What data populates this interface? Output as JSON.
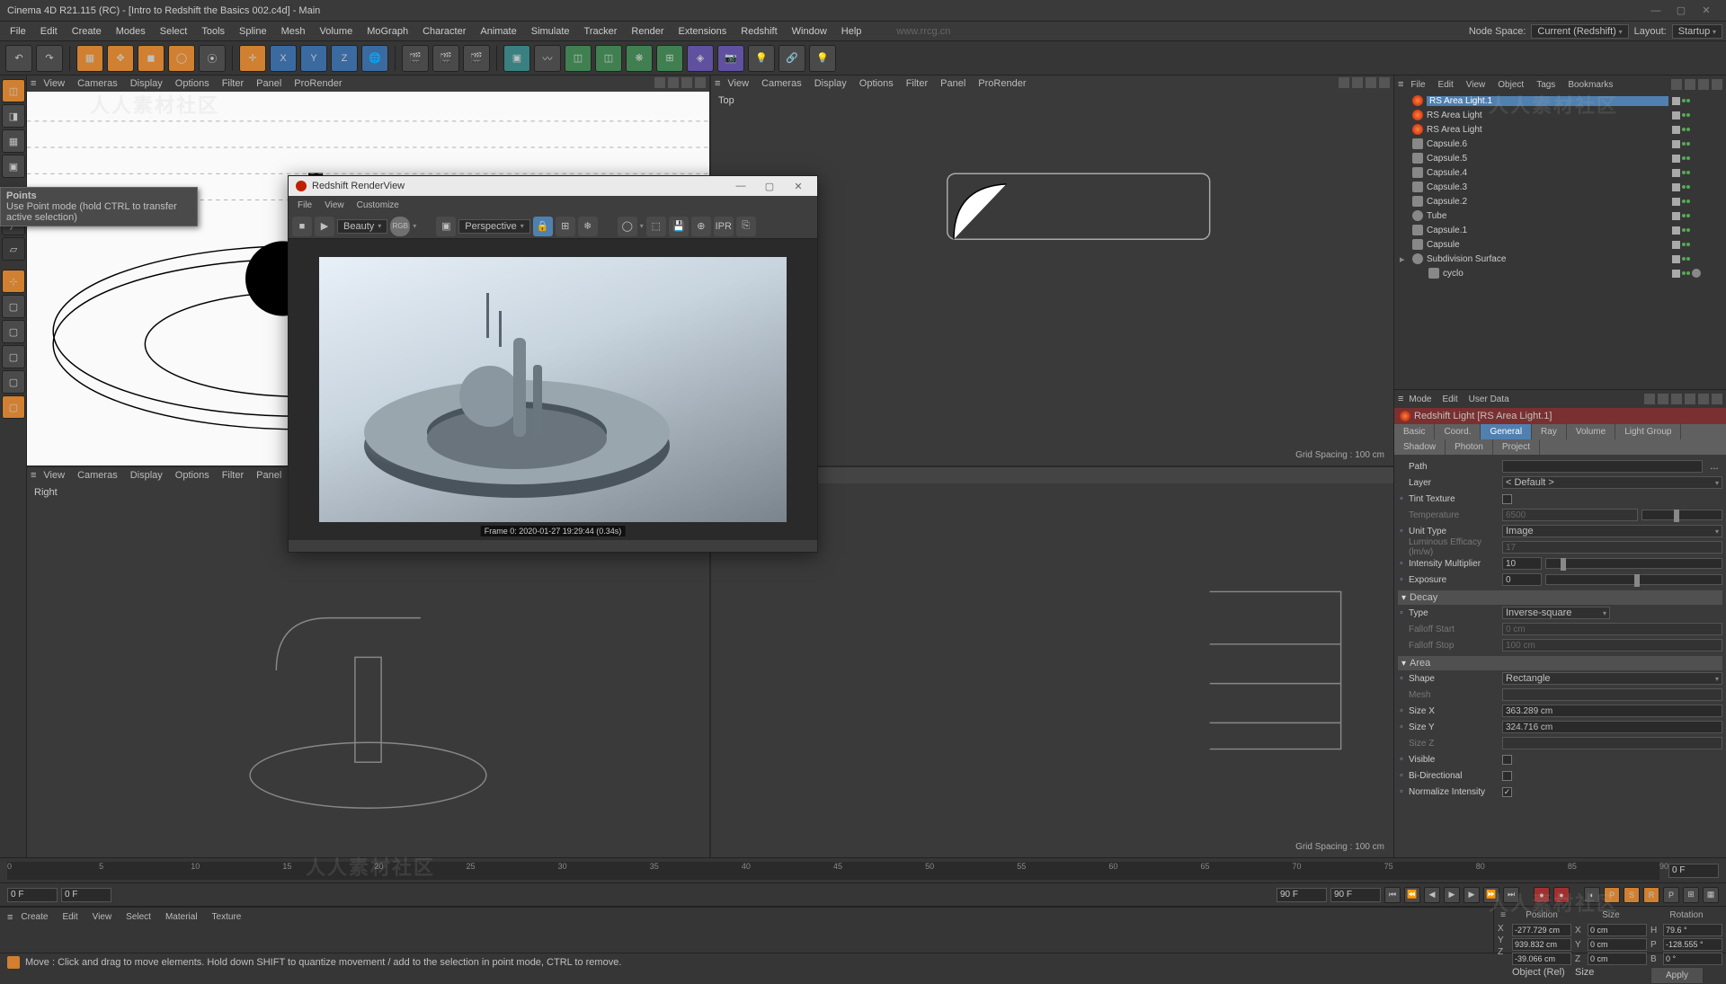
{
  "window": {
    "title": "Cinema 4D R21.115 (RC) - [Intro to Redshift the Basics 002.c4d] - Main",
    "watermark_url": "www.rrcg.cn",
    "watermark_text": "人人素材社区"
  },
  "menubar": {
    "items": [
      "File",
      "Edit",
      "Create",
      "Modes",
      "Select",
      "Tools",
      "Spline",
      "Mesh",
      "Volume",
      "MoGraph",
      "Character",
      "Animate",
      "Simulate",
      "Tracker",
      "Render",
      "Extensions",
      "Redshift",
      "Window",
      "Help"
    ],
    "node_space_label": "Node Space:",
    "node_space_value": "Current (Redshift)",
    "layout_label": "Layout:",
    "layout_value": "Startup"
  },
  "viewport_menu": [
    "View",
    "Cameras",
    "Display",
    "Options",
    "Filter",
    "Panel",
    "ProRender"
  ],
  "viewports": {
    "top": "Top",
    "right": "Right",
    "grid": "Grid Spacing : 100 cm"
  },
  "tooltip": {
    "title": "Points",
    "body": "Use Point mode (hold CTRL to transfer active selection)"
  },
  "renderview": {
    "title": "Redshift RenderView",
    "menu": [
      "File",
      "View",
      "Customize"
    ],
    "pass": "Beauty",
    "colorspace": "RGB",
    "camera": "Perspective",
    "frame_text": "Frame  0:   2020-01-27  19:29:44  (0.34s)"
  },
  "object_panel": {
    "menu": [
      "File",
      "Edit",
      "View",
      "Object",
      "Tags",
      "Bookmarks"
    ],
    "items": [
      {
        "icon": "light",
        "name": "RS Area Light.1",
        "sel": true,
        "indent": 0
      },
      {
        "icon": "light",
        "name": "RS Area Light",
        "indent": 0
      },
      {
        "icon": "light",
        "name": "RS Area Light",
        "indent": 0
      },
      {
        "icon": "cap",
        "name": "Capsule.6",
        "indent": 0
      },
      {
        "icon": "cap",
        "name": "Capsule.5",
        "indent": 0
      },
      {
        "icon": "cap",
        "name": "Capsule.4",
        "indent": 0
      },
      {
        "icon": "cap",
        "name": "Capsule.3",
        "indent": 0
      },
      {
        "icon": "cap",
        "name": "Capsule.2",
        "indent": 0
      },
      {
        "icon": "tube",
        "name": "Tube",
        "indent": 0
      },
      {
        "icon": "cap",
        "name": "Capsule.1",
        "indent": 0
      },
      {
        "icon": "cap",
        "name": "Capsule",
        "indent": 0
      },
      {
        "icon": "subd",
        "name": "Subdivision Surface",
        "indent": 0,
        "expand": true
      },
      {
        "icon": "cap",
        "name": "cyclo",
        "indent": 1,
        "extra": true
      }
    ]
  },
  "attribute_panel": {
    "menu": [
      "Mode",
      "Edit",
      "User Data"
    ],
    "object_title": "Redshift Light [RS Area Light.1]",
    "tabs_row1": [
      "Basic",
      "Coord.",
      "General",
      "Ray",
      "Volume",
      "Light Group",
      "Shadow"
    ],
    "tabs_row2": [
      "Photon",
      "Project"
    ],
    "active_tab": "General",
    "props": {
      "path_label": "Path",
      "path_value": "",
      "layer_label": "Layer",
      "layer_value": "< Default >",
      "tint_label": "Tint Texture",
      "temperature_label": "Temperature",
      "temperature_value": "6500",
      "unit_type_label": "Unit Type",
      "unit_type_value": "Image",
      "lum_eff_label": "Luminous Efficacy (lm/w)",
      "lum_eff_value": "17",
      "intensity_label": "Intensity Multiplier",
      "intensity_value": "10",
      "exposure_label": "Exposure",
      "exposure_value": "0",
      "decay_header": "Decay",
      "decay_type_label": "Type",
      "decay_type_value": "Inverse-square",
      "falloff_start_label": "Falloff Start",
      "falloff_start_value": "0 cm",
      "falloff_stop_label": "Falloff Stop",
      "falloff_stop_value": "100 cm",
      "area_header": "Area",
      "shape_label": "Shape",
      "shape_value": "Rectangle",
      "mesh_label": "Mesh",
      "sizex_label": "Size X",
      "sizex_value": "363.289 cm",
      "sizey_label": "Size Y",
      "sizey_value": "324.716 cm",
      "sizez_label": "Size Z",
      "visible_label": "Visible",
      "bidir_label": "Bi-Directional",
      "normint_label": "Normalize Intensity"
    }
  },
  "timeline": {
    "ticks": [
      "0",
      "5",
      "10",
      "15",
      "20",
      "25",
      "30",
      "35",
      "40",
      "45",
      "50",
      "55",
      "60",
      "65",
      "70",
      "75",
      "80",
      "85",
      "90"
    ],
    "start": "0 F",
    "preview_start": "0 F",
    "preview_end": "90 F",
    "end": "90 F",
    "current": "0 F"
  },
  "material_menu": [
    "Create",
    "Edit",
    "View",
    "Select",
    "Material",
    "Texture"
  ],
  "coords": {
    "headers": [
      "Position",
      "Size",
      "Rotation"
    ],
    "rows": [
      {
        "axis": "X",
        "pos": "-277.729 cm",
        "size": "0 cm",
        "rot_label": "H",
        "rot": "79.6 °"
      },
      {
        "axis": "Y",
        "pos": "939.832 cm",
        "size": "0 cm",
        "rot_label": "P",
        "rot": "-128.555 °"
      },
      {
        "axis": "Z",
        "pos": "-39.066 cm",
        "size": "0 cm",
        "rot_label": "B",
        "rot": "0 °"
      }
    ],
    "mode1": "Object (Rel)",
    "mode2": "Size",
    "apply": "Apply"
  },
  "statusbar": "Move : Click and drag to move elements. Hold down SHIFT to quantize movement / add to the selection in point mode, CTRL to remove.",
  "hamburger": "≡"
}
